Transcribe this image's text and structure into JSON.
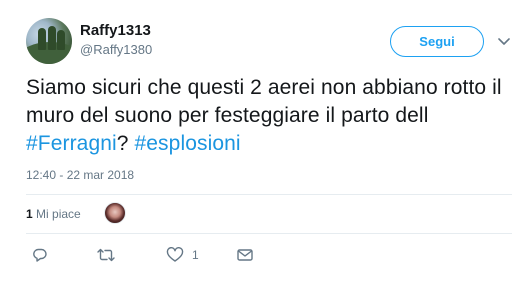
{
  "user": {
    "display_name": "Raffy1313",
    "handle": "@Raffy1380"
  },
  "follow_button": {
    "label": "Segui"
  },
  "tweet": {
    "text_before": "Siamo sicuri che questi 2 aerei non abbiano rotto il muro del suono per festeggiare il parto dell ",
    "hashtag_1": "#Ferragni",
    "text_between": "?  ",
    "hashtag_2": "#esplosioni",
    "timestamp": "12:40 - 22 mar 2018"
  },
  "stats": {
    "likes_number": "1",
    "likes_label": "Mi piace"
  },
  "actions": {
    "like_count": "1"
  },
  "colors": {
    "accent": "#1da1f2",
    "hashtag": "#1b95e0",
    "muted": "#657786",
    "divider": "#e6ecf0"
  },
  "icons": [
    "avatar",
    "chevron-down-icon",
    "reply-icon",
    "retweet-icon",
    "heart-icon",
    "direct-message-icon"
  ]
}
